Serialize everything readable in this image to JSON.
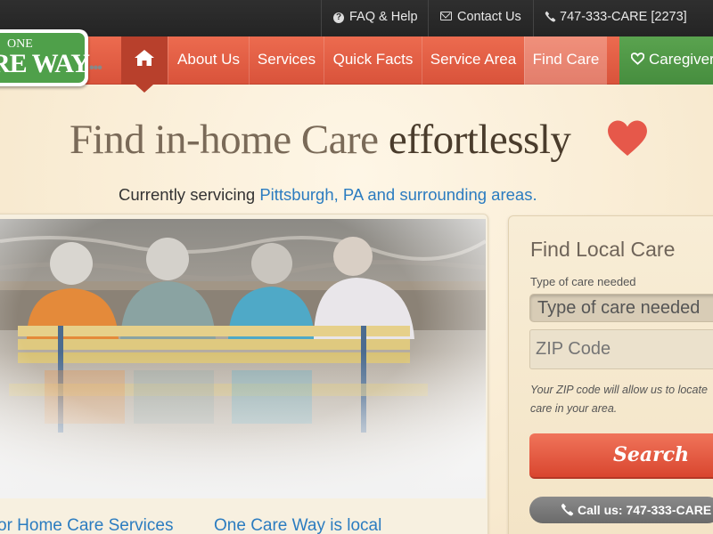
{
  "topbar": {
    "faq": "FAQ & Help",
    "contact": "Contact Us",
    "phone": "747-333-CARE [2273]"
  },
  "logo": {
    "line1": "ONE",
    "line2": "RE WAY"
  },
  "nav": {
    "items": [
      {
        "label": "About Us"
      },
      {
        "label": "Services"
      },
      {
        "label": "Quick Facts"
      },
      {
        "label": "Service Area"
      },
      {
        "label": "Find Care"
      }
    ],
    "caregiver": "Caregiver"
  },
  "hero": {
    "headline_light": "Find in-home Care",
    "headline_dark": "effortlessly",
    "sub_prefix": "Currently servicing",
    "sub_link": "Pittsburgh, PA and surrounding areas."
  },
  "form": {
    "title": "Find Local Care",
    "type_label": "Type of care needed",
    "type_select": "Type of care needed",
    "zip_placeholder": "ZIP Code",
    "zip_hint": "Your ZIP code will allow us to locate care in your area.",
    "search": "Search",
    "call": "Call us: 747-333-CARE"
  },
  "bottom_links": {
    "left": "or Home Care Services",
    "right": "One Care Way is local"
  },
  "colors": {
    "nav_red": "#e35f45",
    "caregiver_green": "#4f9a45",
    "link_blue": "#2b7cc0",
    "heart": "#e6584a"
  }
}
